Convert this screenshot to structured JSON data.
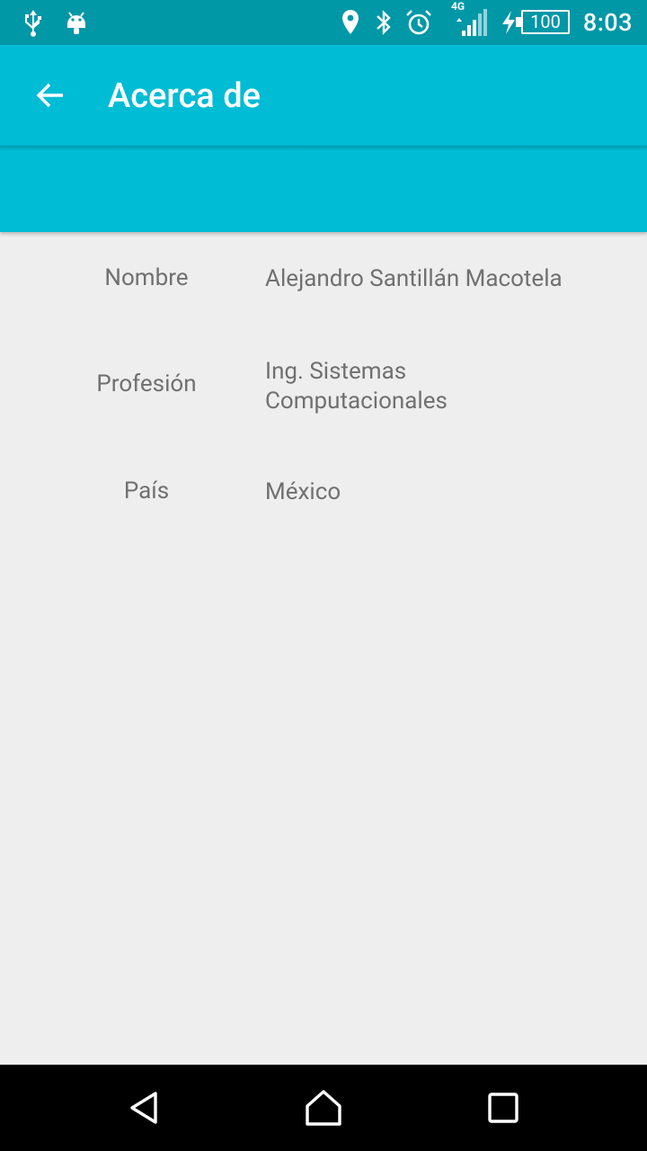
{
  "status_bar": {
    "time": "8:03",
    "battery": "100",
    "network": "4G",
    "icons": [
      "usb-icon",
      "android-icon",
      "location-icon",
      "bluetooth-icon",
      "alarm-icon",
      "signal-icon",
      "charging-icon",
      "battery-icon"
    ]
  },
  "toolbar": {
    "title": "Acerca de",
    "back_icon": "arrow-back-icon",
    "color": "#00bcd4"
  },
  "about": {
    "rows": [
      {
        "label": "Nombre",
        "value": "Alejandro Santillán Macotela"
      },
      {
        "label": "Profesión",
        "value_line1": "Ing. Sistemas",
        "value_line2": "Computacionales"
      },
      {
        "label": "País",
        "value": "México"
      }
    ]
  },
  "colors": {
    "status_bar": "#0097a7",
    "toolbar": "#00bcd4",
    "background": "#eeeeee",
    "text": "#707070"
  },
  "nav_bar": {
    "icons": [
      "back-triangle-icon",
      "home-icon",
      "recents-icon"
    ]
  }
}
